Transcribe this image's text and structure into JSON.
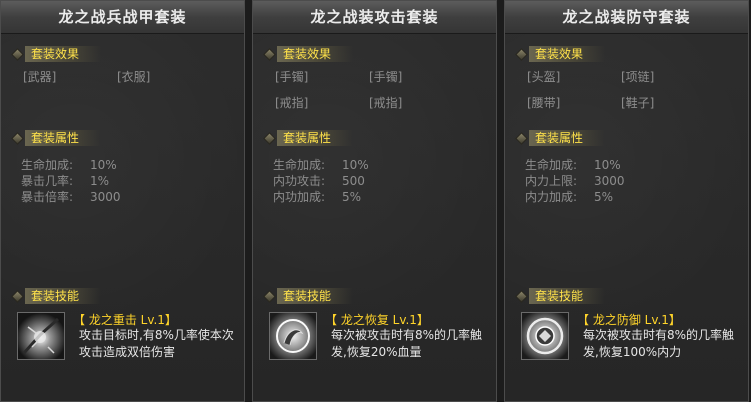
{
  "panels": [
    {
      "title": "龙之战兵战甲套装",
      "effect_header": "套装效果",
      "slots": [
        "[武器]",
        "[衣服]"
      ],
      "attr_header": "套装属性",
      "attrs": [
        {
          "name": "生命加成:",
          "value": "10%"
        },
        {
          "name": "暴击几率:",
          "value": "1%"
        },
        {
          "name": "暴击倍率:",
          "value": "3000"
        }
      ],
      "skill_header": "套装技能",
      "skill_icon": "dragon-strike-icon",
      "skill_name": "【 龙之重击 Lv.1】",
      "skill_desc": "攻击目标时,有8%几率使本次攻击造成双倍伤害"
    },
    {
      "title": "龙之战装攻击套装",
      "effect_header": "套装效果",
      "slots": [
        "[手镯]",
        "[手镯]",
        "[戒指]",
        "[戒指]"
      ],
      "attr_header": "套装属性",
      "attrs": [
        {
          "name": "生命加成:",
          "value": "10%"
        },
        {
          "name": "内功攻击:",
          "value": "500"
        },
        {
          "name": "内功加成:",
          "value": "5%"
        }
      ],
      "skill_header": "套装技能",
      "skill_icon": "dragon-recovery-icon",
      "skill_name": "【 龙之恢复 Lv.1】",
      "skill_desc": "每次被攻击时有8%的几率触发,恢复20%血量"
    },
    {
      "title": "龙之战装防守套装",
      "effect_header": "套装效果",
      "slots": [
        "[头盔]",
        "[项链]",
        "[腰带]",
        "[鞋子]"
      ],
      "attr_header": "套装属性",
      "attrs": [
        {
          "name": "生命加成:",
          "value": "10%"
        },
        {
          "name": "内力上限:",
          "value": "3000"
        },
        {
          "name": "内力加成:",
          "value": "5%"
        }
      ],
      "skill_header": "套装技能",
      "skill_icon": "dragon-defense-icon",
      "skill_name": "【 龙之防御 Lv.1】",
      "skill_desc": "每次被攻击时有8%的几率触发,恢复100%内力"
    }
  ]
}
